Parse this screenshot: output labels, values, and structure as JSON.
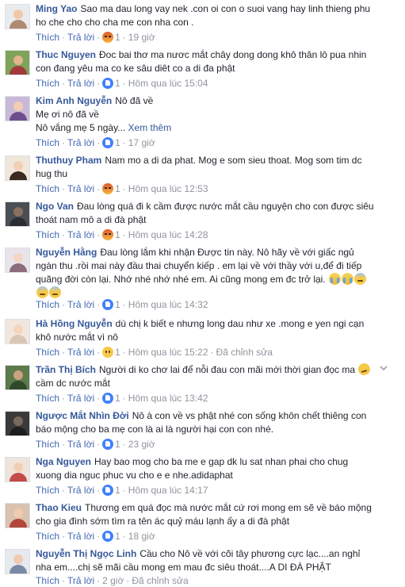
{
  "labels": {
    "like": "Thích",
    "reply": "Trả lời",
    "edited": "Đã chỉnh sửa",
    "see_more": "Xem thêm"
  },
  "colors": {
    "link": "#365899",
    "action": "#4267b2",
    "meta": "#90949c",
    "text": "#1d2129"
  },
  "comments": [
    {
      "author": "Ming Yao",
      "text": "Sao ma dau long vay nek .con oi con o suoi vang hay linh thieng phu ho che cho cho cha me con nha con .",
      "reaction": "angry",
      "reaction_count": "1",
      "time": "19 giờ"
    },
    {
      "author": "Thuc Nguyen",
      "text": "Đoc bai thơ ma nươc mắt chây dong dong khô thân lô pua nhin con đang yêu ma co ke sâu diêt co a di đa phật",
      "reaction": "like",
      "reaction_count": "1",
      "time": "Hôm qua lúc 15:04"
    },
    {
      "author": "Kim Anh Nguyễn",
      "text": "Nô đã về",
      "line2": "Mẹ ơi nô đã về",
      "line3": "Nô vắng mẹ 5 ngày...",
      "reaction": "like",
      "reaction_count": "1",
      "time": "17 giờ"
    },
    {
      "author": "Thuthuy Pham",
      "text": "Nam mo a di da phat. Mog e som sieu thoat. Mog som tim dc hug thu",
      "reaction": "angry",
      "reaction_count": "1",
      "time": "Hôm qua lúc 12:53"
    },
    {
      "author": "Ngo Van",
      "text": "Đau lòng quá đi k cầm được nước mắt cầu nguyện cho con được siêu thoát nam mô a di đà phật",
      "reaction": "angry",
      "reaction_count": "1",
      "time": "Hôm qua lúc 14:28"
    },
    {
      "author": "Nguyễn Hằng",
      "text": "Đau lòng lắm khi nhận Được tin này. Nô hãy về với giấc ngủ ngàn thu .rồi mai này đầu thai chuyển kiếp . em lại về với thầy với u,để đi tiếp quãng đời còn lại. Nhớ nhé nhớ nhé em. Ai cũng mong em đc trở lại.",
      "reaction": "like",
      "reaction_count": "1",
      "time": "Hôm qua lúc 14:32"
    },
    {
      "author": "Hà Hồng Nguyễn",
      "text": "dù chị k biết e nhưng long dau như xe .mong e yen ngi cạn khô nước mắt vì nô",
      "reaction": "sad",
      "reaction_count": "1",
      "time": "Hôm qua lúc 15:22"
    },
    {
      "author": "Trần Thị Bích",
      "text": "Người di ko chơ lai để nỗi đau con mãi mới thời gian đọc ma",
      "line2": "cầm dc nước mắt",
      "reaction": "like",
      "reaction_count": "1",
      "time": "Hôm qua lúc 13:42"
    },
    {
      "author": "Ngược Mắt Nhìn Đời",
      "text": "Nô à con về vs phật nhé con sống khôn chết thiêng con báo mộng cho ba mẹ con là ai là người hại con con nhé.",
      "reaction": "like",
      "reaction_count": "1",
      "time": "23 giờ"
    },
    {
      "author": "Nga Nguyen",
      "text": "Hay bao mog cho ba me e gap dk lu sat nhan phai cho chug xuong dia nguc phuc vu cho e e nhe.adidaphat",
      "reaction": "like",
      "reaction_count": "1",
      "time": "Hôm qua lúc 14:17"
    },
    {
      "author": "Thao Kieu",
      "text": "Thương em quá đọc mà nước mắt cứ rơi mong em sẽ về báo mộng cho gia đình sớm tìm ra tên ác quỷ máu lạnh ấy a di đà phật",
      "reaction": "like",
      "reaction_count": "1",
      "time": "18 giờ"
    },
    {
      "author": "Nguyễn Thị Ngọc Linh",
      "text": "Cầu cho Nô về với cõi tây phương cực lạc....an nghỉ nha em....chị sẽ mãi cầu mong em mau đc siêu thoát....A DI ĐÀ PHẬT",
      "time": "2 giờ"
    }
  ]
}
